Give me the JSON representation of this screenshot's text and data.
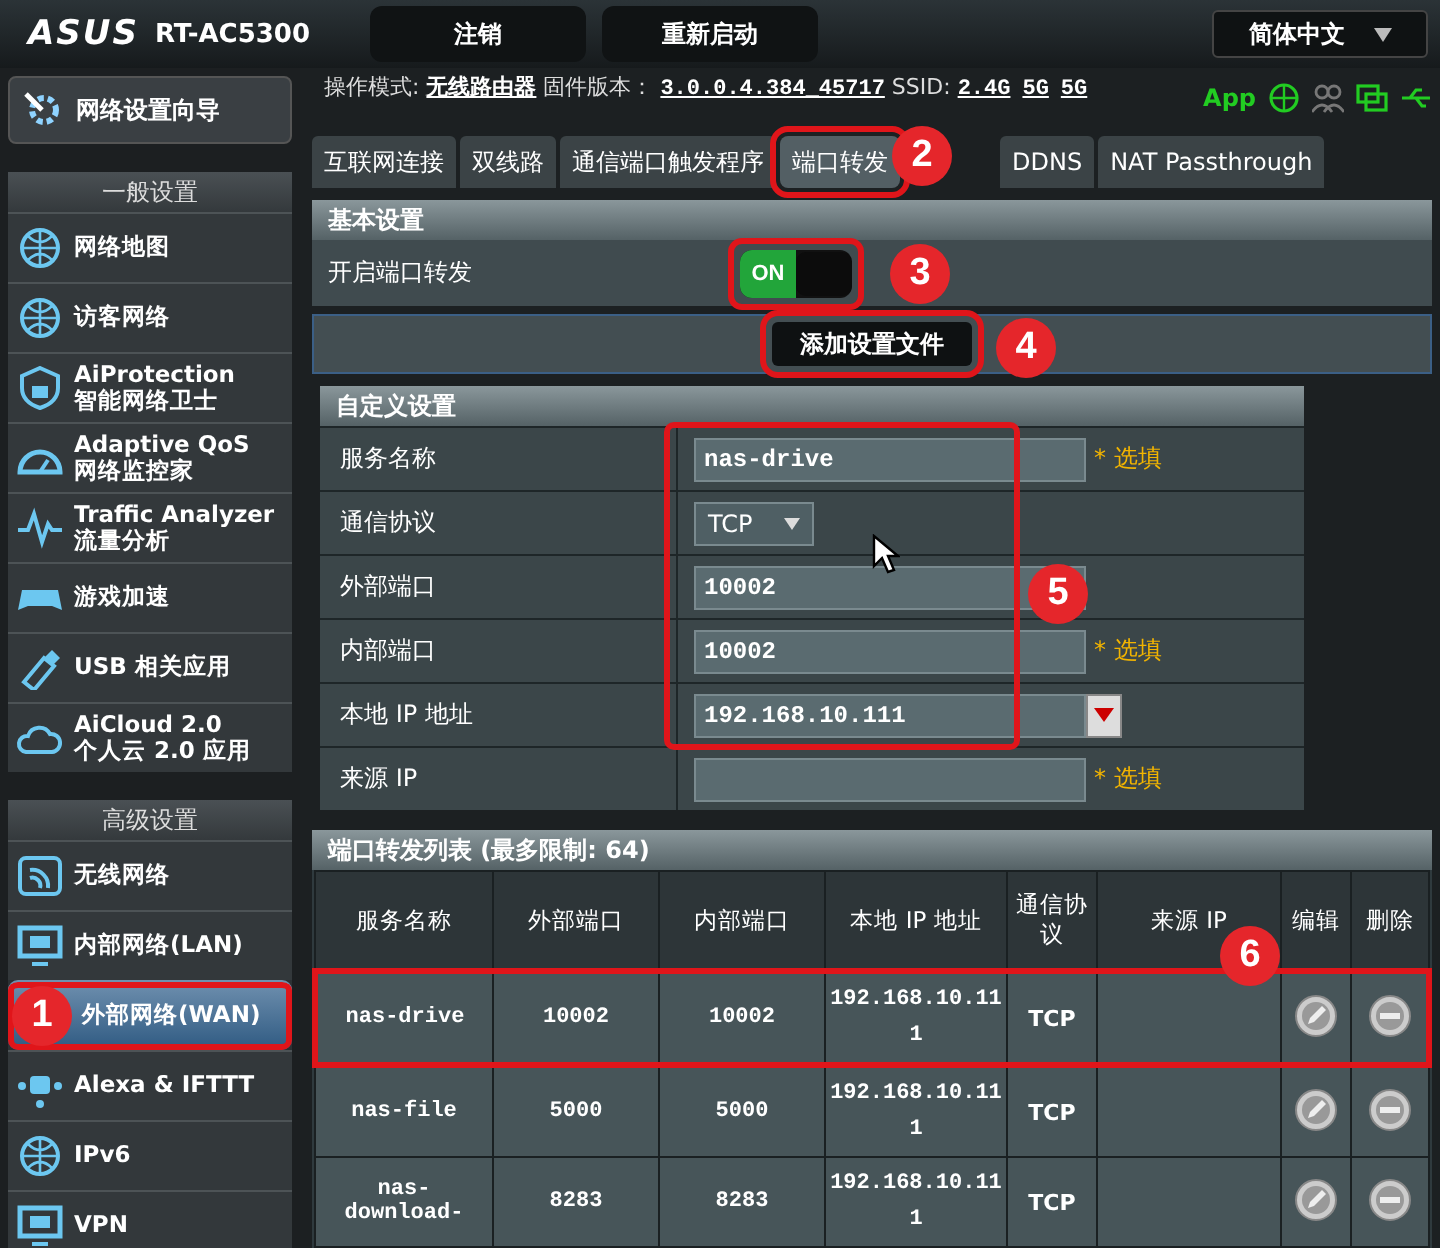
{
  "header": {
    "logo": "ASUS",
    "model": "RT-AC5300",
    "buttons": [
      "注销",
      "重新启动"
    ],
    "language": "简体中文"
  },
  "sidebar": {
    "wizard": "网络设置向导",
    "sections": [
      {
        "title": "一般设置",
        "items": [
          {
            "label": "网络地图",
            "selected": false,
            "highlighted": false
          },
          {
            "label": "访客网络",
            "selected": false,
            "highlighted": false
          },
          {
            "label": "AiProtection",
            "sublabel": "智能网络卫士",
            "selected": false,
            "highlighted": false
          },
          {
            "label": "Adaptive QoS",
            "sublabel": "网络监控家",
            "selected": false,
            "highlighted": false
          },
          {
            "label": "Traffic Analyzer",
            "sublabel": "流量分析",
            "selected": false,
            "highlighted": false
          },
          {
            "label": "游戏加速",
            "selected": false,
            "highlighted": false
          },
          {
            "label": "USB 相关应用",
            "selected": false,
            "highlighted": false
          },
          {
            "label": "AiCloud 2.0",
            "sublabel": "个人云 2.0 应用",
            "selected": false,
            "highlighted": false
          }
        ]
      },
      {
        "title": "高级设置",
        "items": [
          {
            "label": "无线网络",
            "selected": false,
            "highlighted": false
          },
          {
            "label": "内部网络(LAN)",
            "selected": false,
            "highlighted": false
          },
          {
            "label": "外部网络(WAN)",
            "selected": true,
            "highlighted": true
          },
          {
            "label": "Alexa & IFTTT",
            "selected": false,
            "highlighted": false
          },
          {
            "label": "IPv6",
            "selected": false,
            "highlighted": false
          },
          {
            "label": "VPN",
            "selected": false,
            "highlighted": false
          }
        ]
      }
    ]
  },
  "info": {
    "mode_label": "操作模式:",
    "mode": "无线路由器",
    "firmware_label": "固件版本：",
    "firmware": "3.0.0.4.384_45717",
    "ssid_label": "SSID:",
    "ssids": [
      "2.4G",
      "5G",
      "5G"
    ],
    "app": "App"
  },
  "tabs": [
    {
      "label": "互联网连接",
      "selected": false,
      "highlighted": false
    },
    {
      "label": "双线路",
      "selected": false,
      "highlighted": false
    },
    {
      "label": "通信端口触发程序",
      "selected": false,
      "highlighted": false
    },
    {
      "label": "端口转发",
      "selected": true,
      "highlighted": true
    },
    {
      "label": "DDNS",
      "selected": false,
      "highlighted": false
    },
    {
      "label": "NAT Passthrough",
      "selected": false,
      "highlighted": false
    }
  ],
  "basic": {
    "title": "基本设置",
    "toggle_label": "开启端口转发",
    "toggle": {
      "on": true,
      "text": "ON",
      "highlighted": true
    }
  },
  "add_button": {
    "label": "添加设置文件",
    "highlighted": true
  },
  "custom": {
    "title": "自定义设置",
    "highlighted": true,
    "fields": [
      {
        "kind": "text",
        "label": "服务名称",
        "value": "nas-drive",
        "note": "* 选填"
      },
      {
        "kind": "select",
        "label": "通信协议",
        "value": "TCP"
      },
      {
        "kind": "text",
        "label": "外部端口",
        "value": "10002"
      },
      {
        "kind": "text",
        "label": "内部端口",
        "value": "10002",
        "note": "* 选填"
      },
      {
        "kind": "combo",
        "label": "本地 IP 地址",
        "value": "192.168.10.111"
      },
      {
        "kind": "text",
        "label": "来源 IP",
        "note": "* 选填"
      }
    ]
  },
  "table": {
    "title": "端口转发列表 (最多限制: 64)",
    "columns": [
      "服务名称",
      "外部端口",
      "内部端口",
      "本地 IP 地址",
      "通信协议",
      "来源 IP",
      "编辑",
      "删除"
    ],
    "rows": [
      {
        "service": "nas-drive",
        "external": "10002",
        "internal": "10002",
        "ip": "192.168.10.111",
        "protocol": "TCP",
        "highlighted": true
      },
      {
        "service": "nas-file",
        "external": "5000",
        "internal": "5000",
        "ip": "192.168.10.111",
        "protocol": "TCP",
        "highlighted": false
      },
      {
        "service": "nas-download-",
        "external": "8283",
        "internal": "8283",
        "ip": "192.168.10.111",
        "protocol": "TCP",
        "highlighted": false
      }
    ]
  },
  "callouts": [
    {
      "number": "1"
    },
    {
      "number": "2"
    },
    {
      "number": "3"
    },
    {
      "number": "4"
    },
    {
      "number": "5"
    },
    {
      "number": "6"
    }
  ]
}
